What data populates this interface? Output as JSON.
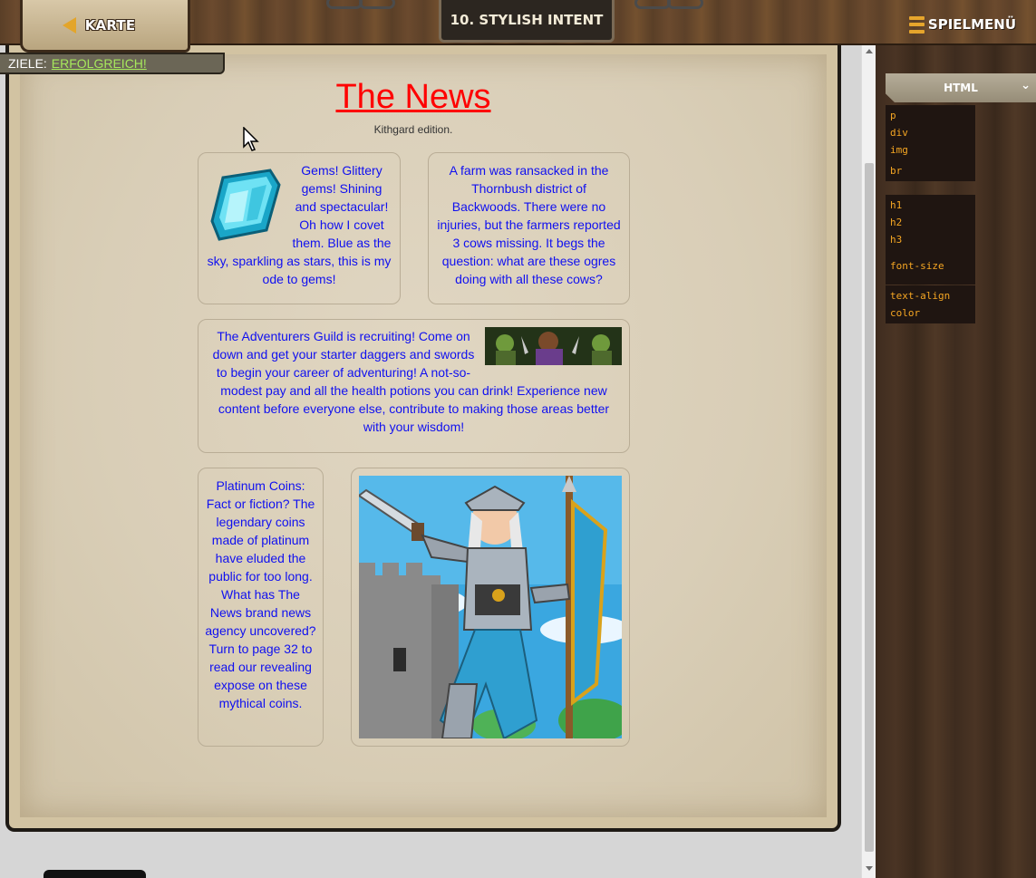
{
  "header": {
    "map_label": "KARTE",
    "level_title": "10. STYLISH INTENT",
    "menu_label": "SPIELMENÜ"
  },
  "goals": {
    "label": "ZIELE:",
    "status": "ERFOLGREICH!"
  },
  "page": {
    "title": "The News",
    "subtitle": "Kithgard edition.",
    "articles": [
      {
        "text": "Gems! Glittery gems! Shining and spectacular! Oh how I covet them. Blue as the sky, sparkling as stars, this is my ode to gems!",
        "image": "gem-image"
      },
      {
        "text": "A farm was ransacked in the Thornbush district of Backwoods. There were no injuries, but the farmers reported 3 cows missing. It begs the question: what are these ogres doing with all these cows?"
      },
      {
        "text": "The Adventurers Guild is recruiting! Come on down and get your starter daggers and swords to begin your career of adventuring! A not-so-modest pay and all the health potions you can drink! Experience new content before everyone else, contribute to making those areas better with your wisdom!",
        "image": "adventurers-image"
      },
      {
        "text": "Platinum Coins: Fact or fiction? The legendary coins made of platinum have eluded the public for too long. What has The News brand news agency uncovered? Turn to page 32 to read our revealing expose on these mythical coins."
      },
      {
        "image": "warrior-image"
      }
    ]
  },
  "palette": {
    "title": "HTML",
    "groups": [
      [
        "p",
        "div",
        "img"
      ],
      [
        "br"
      ],
      [
        "h1",
        "h2",
        "h3"
      ],
      [
        "font-size"
      ],
      [
        "text-align",
        "color"
      ]
    ]
  },
  "colors": {
    "title": "#ff0000",
    "article_text": "#1010f0",
    "snippet": "#f5a623",
    "goal_success": "#a6e85c"
  }
}
